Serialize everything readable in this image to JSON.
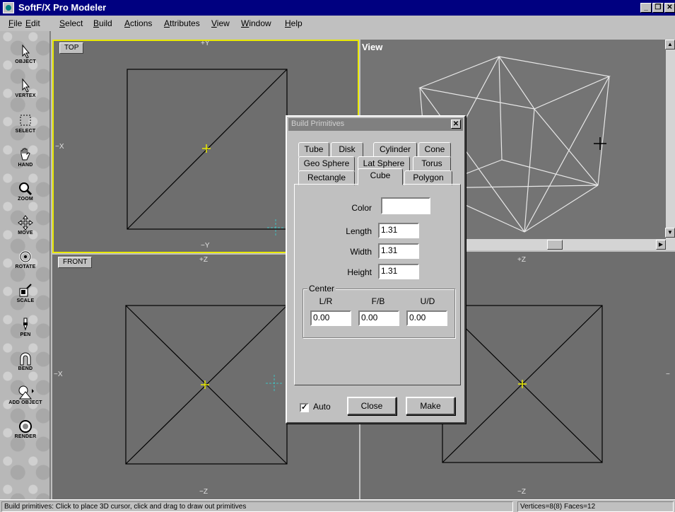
{
  "app": {
    "title": "SoftF/X Pro Modeler"
  },
  "menu": [
    "File",
    "Edit",
    "Select",
    "Build",
    "Actions",
    "Attributes",
    "View",
    "Window",
    "Help"
  ],
  "tools": [
    {
      "label": "OBJECT",
      "icon": "arrow-icon"
    },
    {
      "label": "VERTEX",
      "icon": "vertex-arrow-icon"
    },
    {
      "label": "SELECT",
      "icon": "select-box-icon"
    },
    {
      "label": "HAND",
      "icon": "hand-icon"
    },
    {
      "label": "ZOOM",
      "icon": "magnifier-icon"
    },
    {
      "label": "MOVE",
      "icon": "move-icon"
    },
    {
      "label": "ROTATE",
      "icon": "rotate-icon"
    },
    {
      "label": "SCALE",
      "icon": "scale-icon"
    },
    {
      "label": "PEN",
      "icon": "pen-icon"
    },
    {
      "label": "BEND",
      "icon": "bend-icon"
    },
    {
      "label": "ADD OBJECT",
      "icon": "add-object-icon"
    },
    {
      "label": "RENDER",
      "icon": "render-icon"
    }
  ],
  "viewports": {
    "top": {
      "tag": "TOP",
      "axis_top": "+Y",
      "axis_bottom": "−Y",
      "axis_left": "−X"
    },
    "view": {
      "tag": "View"
    },
    "front": {
      "tag": "FRONT",
      "axis_top": "+Z",
      "axis_bottom": "−Z",
      "axis_left": "−X"
    },
    "side": {
      "axis_top": "+Z",
      "axis_bottom": "−Z"
    }
  },
  "dialog": {
    "title": "Build Primitives",
    "tabs_row1": [
      "Tube",
      "Disk",
      "Cylinder",
      "Cone"
    ],
    "tabs_row2": [
      "Geo Sphere",
      "Lat Sphere",
      "Torus"
    ],
    "tabs_row3": [
      "Rectangle",
      "Cube",
      "Polygon"
    ],
    "active_tab": "Cube",
    "color_label": "Color",
    "length_label": "Length",
    "length_value": "1.31",
    "width_label": "Width",
    "width_value": "1.31",
    "height_label": "Height",
    "height_value": "1.31",
    "center_label": "Center",
    "lr_label": "L/R",
    "fb_label": "F/B",
    "ud_label": "U/D",
    "lr_value": "0.00",
    "fb_value": "0.00",
    "ud_value": "0.00",
    "auto_label": "Auto",
    "auto_checked": "✓",
    "close_label": "Close",
    "make_label": "Make"
  },
  "status": {
    "message": "Build primitives: Click to place 3D cursor, click and drag to draw out primitives",
    "counts": "Vertices=8(8) Faces=12"
  },
  "colors": {
    "titlebar": "#000080",
    "viewport": "#6e6e6e",
    "active_border": "#e8e800",
    "cursor": "#e8e800"
  }
}
